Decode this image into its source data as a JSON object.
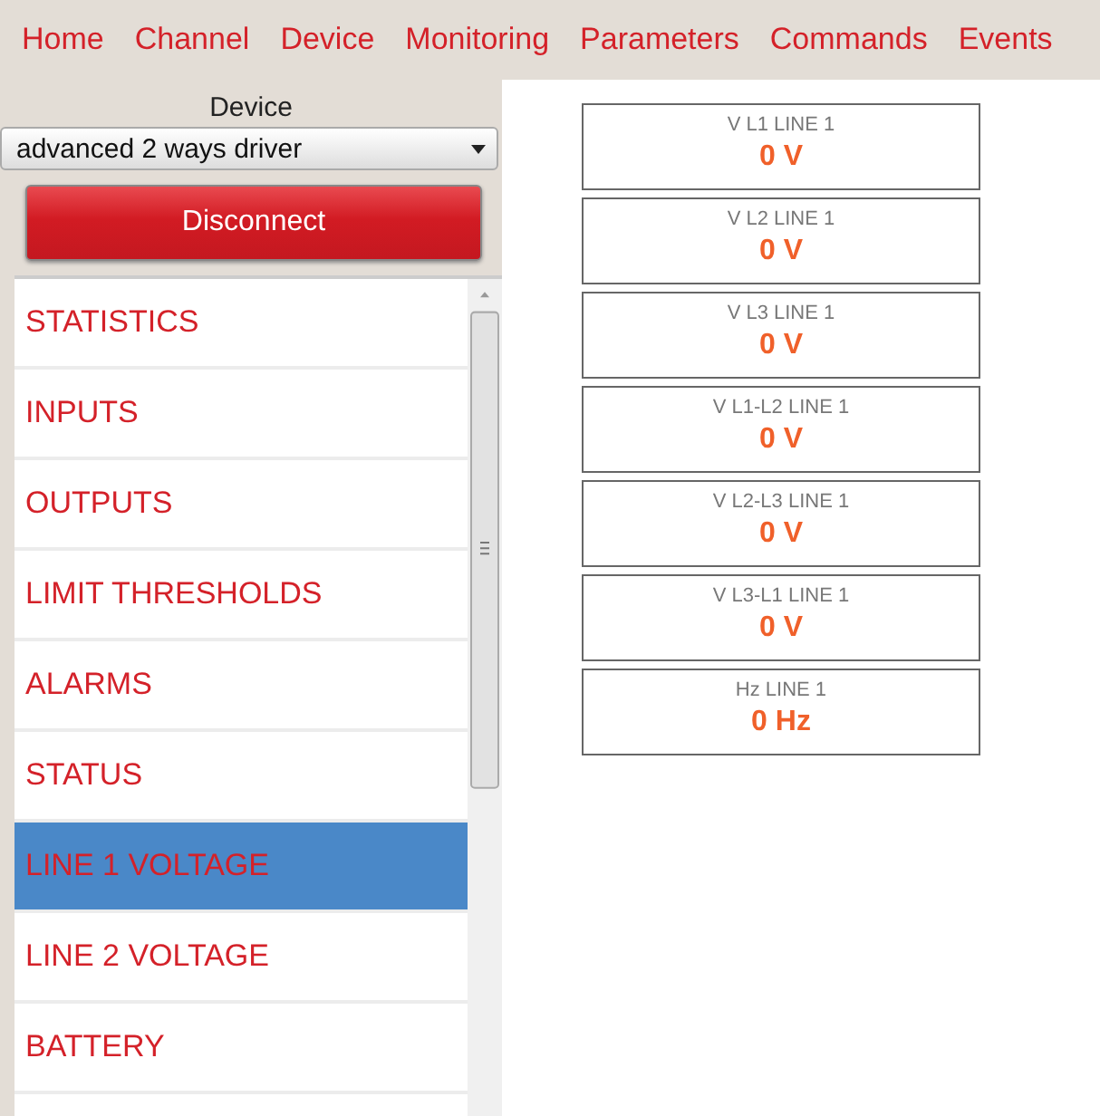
{
  "nav": [
    {
      "label": "Home"
    },
    {
      "label": "Channel"
    },
    {
      "label": "Device"
    },
    {
      "label": "Monitoring"
    },
    {
      "label": "Parameters"
    },
    {
      "label": "Commands"
    },
    {
      "label": "Events"
    }
  ],
  "device": {
    "label": "Device",
    "value": "advanced 2 ways driver",
    "button": "Disconnect"
  },
  "menu": [
    {
      "label": "STATISTICS",
      "selected": false
    },
    {
      "label": "INPUTS",
      "selected": false
    },
    {
      "label": "OUTPUTS",
      "selected": false
    },
    {
      "label": "LIMIT THRESHOLDS",
      "selected": false
    },
    {
      "label": "ALARMS",
      "selected": false
    },
    {
      "label": "STATUS",
      "selected": false
    },
    {
      "label": "LINE 1 VOLTAGE",
      "selected": true
    },
    {
      "label": "LINE 2 VOLTAGE",
      "selected": false
    },
    {
      "label": "BATTERY",
      "selected": false
    }
  ],
  "readings": [
    {
      "label": "V L1 LINE 1",
      "value": "0 V"
    },
    {
      "label": "V L2 LINE 1",
      "value": "0 V"
    },
    {
      "label": "V L3 LINE 1",
      "value": "0 V"
    },
    {
      "label": "V L1-L2 LINE 1",
      "value": "0 V"
    },
    {
      "label": "V L2-L3 LINE 1",
      "value": "0 V"
    },
    {
      "label": "V L3-L1 LINE 1",
      "value": "0 V"
    },
    {
      "label": "Hz LINE 1",
      "value": "0 Hz"
    }
  ]
}
